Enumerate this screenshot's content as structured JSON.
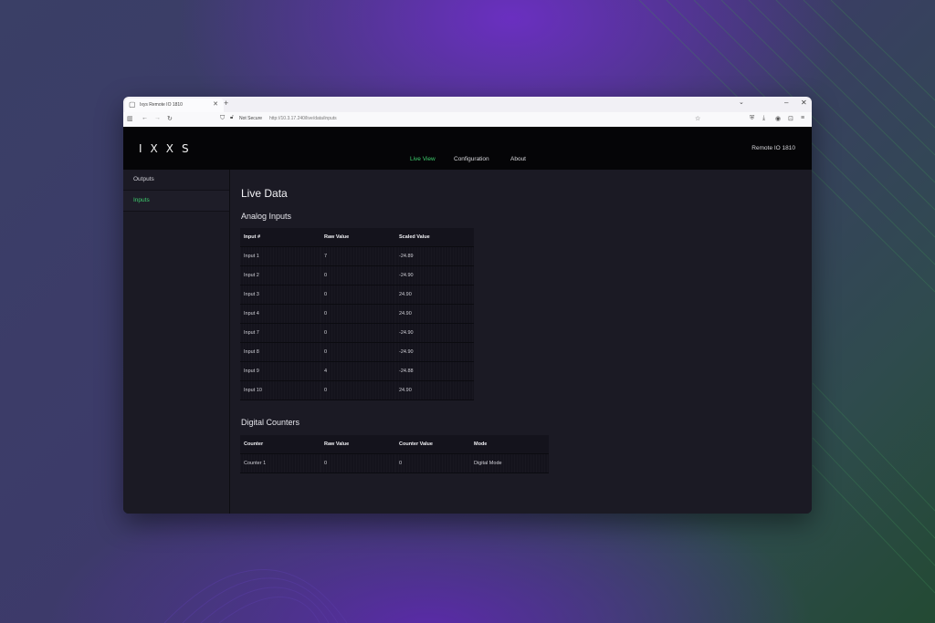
{
  "browser": {
    "tab_title": "Ixys Remote IO 1810",
    "new_tab": "+",
    "url_security": "Not Secure",
    "url": "http://10.3.17.240/live/data/inputs"
  },
  "app": {
    "logo": "IXXS",
    "nav": [
      "Live View",
      "Configuration",
      "About"
    ],
    "remote_id": "Remote IO 1810"
  },
  "sidebar": {
    "items": [
      "Outputs",
      "Inputs"
    ]
  },
  "page": {
    "title": "Live Data",
    "analog": {
      "title": "Analog Inputs",
      "columns": [
        "Input #",
        "Raw Value",
        "Scaled Value"
      ],
      "rows": [
        [
          "Input 1",
          "7",
          "-24.89"
        ],
        [
          "Input 2",
          "0",
          "-24.90"
        ],
        [
          "Input 3",
          "0",
          "24.90"
        ],
        [
          "Input 4",
          "0",
          "24.90"
        ],
        [
          "Input 7",
          "0",
          "-24.90"
        ],
        [
          "Input 8",
          "0",
          "-24.90"
        ],
        [
          "Input 9",
          "4",
          "-24.88"
        ],
        [
          "Input 10",
          "0",
          "24.90"
        ]
      ]
    },
    "counters": {
      "title": "Digital Counters",
      "columns": [
        "Counter",
        "Raw Value",
        "Counter Value",
        "Mode"
      ],
      "rows": [
        [
          "Counter 1",
          "0",
          "0",
          "Digital Mode"
        ]
      ]
    }
  },
  "colors": {
    "accent": "#3ecf6e",
    "header_bg": "#050507",
    "panel_bg": "#1b1a24"
  }
}
